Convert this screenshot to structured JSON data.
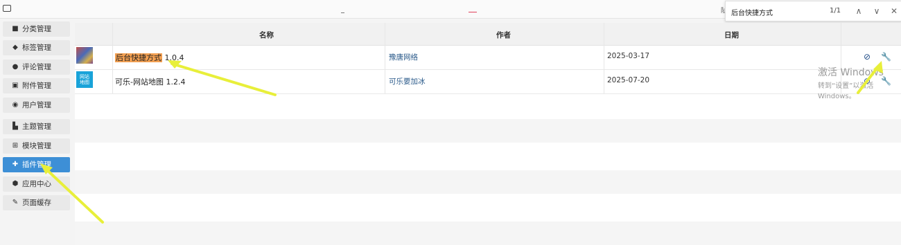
{
  "find_bar": {
    "query": "后台快捷方式",
    "count": "1/1",
    "up": "∧",
    "down": "∨",
    "close": "✕"
  },
  "top_tick": "阯",
  "sidebar": {
    "items": [
      {
        "label": "分类管理",
        "icon": "folder-icon",
        "glyph": "■"
      },
      {
        "label": "标签管理",
        "icon": "tag-icon",
        "glyph": "◆"
      },
      {
        "label": "评论管理",
        "icon": "comment-icon",
        "glyph": "●"
      },
      {
        "label": "附件管理",
        "icon": "archive-icon",
        "glyph": "▣"
      },
      {
        "label": "用户管理",
        "icon": "users-icon",
        "glyph": "◉"
      },
      {
        "label": "主题管理",
        "icon": "layout-icon",
        "glyph": "▙"
      },
      {
        "label": "模块管理",
        "icon": "grid-icon",
        "glyph": "⊞"
      },
      {
        "label": "插件管理",
        "icon": "puzzle-icon",
        "glyph": "✚"
      },
      {
        "label": "应用中心",
        "icon": "cube-icon",
        "glyph": "⬢"
      },
      {
        "label": "页面缓存",
        "icon": "wrench-icon",
        "glyph": "✎"
      }
    ],
    "active_index": 7
  },
  "table": {
    "headers": {
      "name": "名称",
      "author": "作者",
      "date": "日期"
    },
    "rows": [
      {
        "name_highlight": "后台快捷方式",
        "version": "1.0.4",
        "author": "豫唐网络",
        "date": "2025-03-17",
        "disable_icon": "⊘",
        "settings_icon": "🔧"
      },
      {
        "thumb_text": "网站\n地图",
        "name": "可乐-网站地图",
        "version": "1.2.4",
        "author": "可乐要加冰",
        "date": "2025-07-20",
        "disable_icon": "⊘",
        "settings_icon": "🔧"
      }
    ]
  },
  "watermark": {
    "line1": "激活 Windows",
    "line2": "转到“设置”以激活 Windows。"
  },
  "colors": {
    "accent": "#3d8fd6",
    "highlight": "#f3a052",
    "annotation": "#e8ef3a",
    "link": "#2a5a8a"
  }
}
